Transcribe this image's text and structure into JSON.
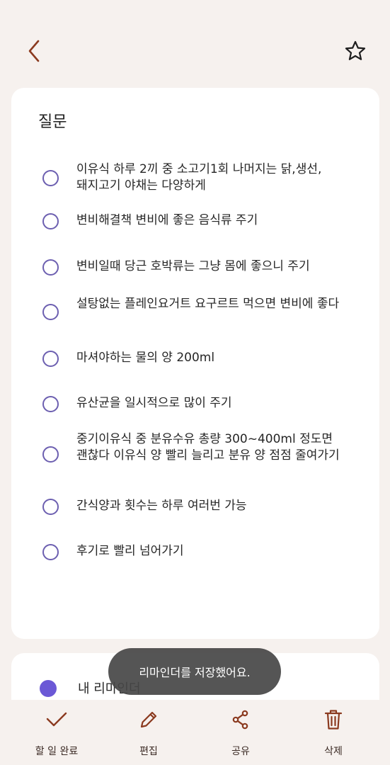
{
  "colors": {
    "background": "#f6f1ee",
    "card": "#ffffff",
    "accent_brown": "#8b3a1f",
    "radio_purple": "#6c5fb0",
    "reminder_dot": "#6b58d6",
    "toast_bg": "#464646"
  },
  "header": {
    "back_icon": "chevron-left-icon",
    "favorite_icon": "star-outline-icon"
  },
  "checklist": {
    "title": "질문",
    "items": [
      {
        "text": "이유식 하루 2끼 중 소고기1회 나머지는 닭,생선,돼지고기 야채는 다양하게",
        "checked": false
      },
      {
        "text": "변비해결책 변비에 좋은 음식류 주기",
        "checked": false
      },
      {
        "text": "변비일때 당근 호박류는 그냥 몸에 좋으니 주기",
        "checked": false
      },
      {
        "text": "설탕없는 플레인요거트 요구르트 먹으면 변비에 좋다",
        "checked": false
      },
      {
        "text": "마셔야하는 물의 양 200ml",
        "checked": false
      },
      {
        "text": "유산균을 일시적으로 많이 주기",
        "checked": false
      },
      {
        "text": "중기이유식 중 분유수유 총량 300~400ml 정도면 괜찮다 이유식 양 빨리 늘리고 분유 양 점점 줄여가기",
        "checked": false
      },
      {
        "text": "간식양과 횟수는 하루 여러번 가능",
        "checked": false
      },
      {
        "text": "후기로 빨리 넘어가기",
        "checked": false
      }
    ]
  },
  "reminder": {
    "label": "내 리마인더"
  },
  "toast": {
    "message": "리마인더를 저장했어요."
  },
  "bottom_bar": {
    "items": [
      {
        "label": "할 일 완료",
        "icon": "checkmark-icon"
      },
      {
        "label": "편집",
        "icon": "pencil-icon"
      },
      {
        "label": "공유",
        "icon": "share-icon"
      },
      {
        "label": "삭제",
        "icon": "trash-icon"
      }
    ]
  }
}
